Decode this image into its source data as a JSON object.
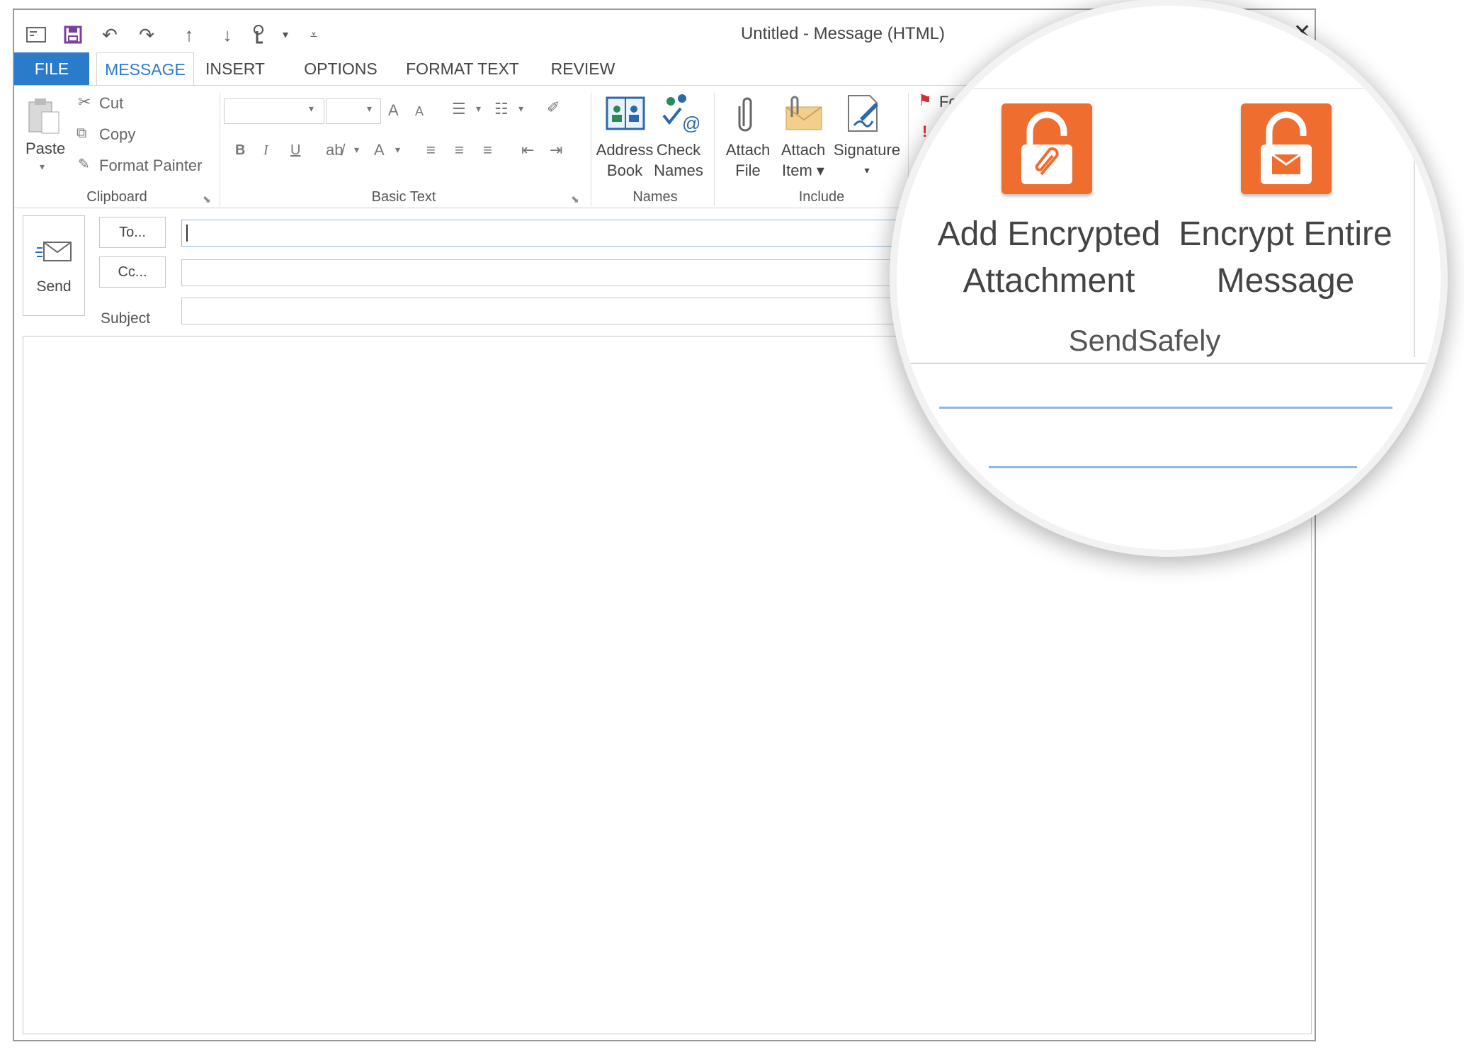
{
  "window": {
    "title": "Untitled - Message (HTML)",
    "controls": {
      "restore": "□",
      "close": "✕"
    }
  },
  "tabs": [
    "FILE",
    "MESSAGE",
    "INSERT",
    "OPTIONS",
    "FORMAT TEXT",
    "REVIEW"
  ],
  "clipboard": {
    "paste": "Paste",
    "cut": "Cut",
    "copy": "Copy",
    "format_painter": "Format Painter",
    "group": "Clipboard"
  },
  "basic_text": {
    "bold": "B",
    "italic": "I",
    "underline": "U",
    "font_color": "A",
    "grow_font": "A",
    "shrink_font": "A",
    "group": "Basic Text"
  },
  "names": {
    "address_book": [
      "Address",
      "Book"
    ],
    "check_names": [
      "Check",
      "Names"
    ],
    "group": "Names"
  },
  "include": {
    "attach_file": [
      "Attach",
      "File"
    ],
    "attach_item": [
      "Attach",
      "Item ▾"
    ],
    "signature": [
      "Signature",
      "▾"
    ],
    "group": "Include"
  },
  "tags": {
    "follow_up": "Follow",
    "high_importance": "Hi"
  },
  "header": {
    "send": "Send",
    "to": "To...",
    "cc": "Cc...",
    "subject": "Subject"
  },
  "sendsafely": {
    "add_attachment": [
      "Add Encrypted",
      "Attachment"
    ],
    "encrypt_message": [
      "Encrypt Entire",
      "Message"
    ],
    "group": "SendSafely",
    "accent": "#ee6d2f"
  }
}
